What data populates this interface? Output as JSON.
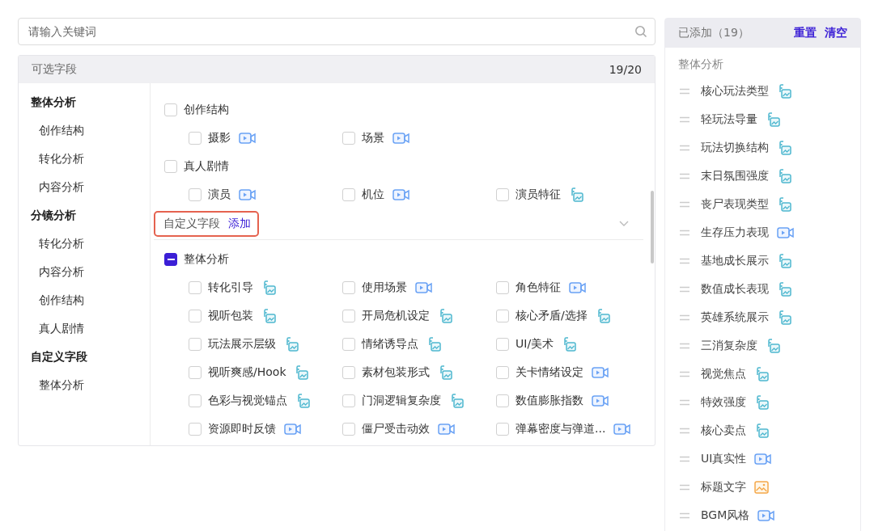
{
  "search": {
    "placeholder": "请输入关键词"
  },
  "fields_panel": {
    "title": "可选字段",
    "count": "19/20",
    "nav": [
      {
        "label": "整体分析",
        "kind": "group"
      },
      {
        "label": "创作结构",
        "kind": "item"
      },
      {
        "label": "转化分析",
        "kind": "item"
      },
      {
        "label": "内容分析",
        "kind": "item"
      },
      {
        "label": "分镜分析",
        "kind": "group"
      },
      {
        "label": "转化分析",
        "kind": "item"
      },
      {
        "label": "内容分析",
        "kind": "item"
      },
      {
        "label": "创作结构",
        "kind": "item"
      },
      {
        "label": "真人剧情",
        "kind": "item"
      },
      {
        "label": "自定义字段",
        "kind": "group"
      },
      {
        "label": "整体分析",
        "kind": "item"
      }
    ],
    "sections": [
      {
        "kind": "group",
        "label": "创作结构",
        "indeterminate": false,
        "items": [
          {
            "label": "摄影",
            "checked": false,
            "kind": "video"
          },
          {
            "label": "场景",
            "checked": false,
            "kind": "video"
          }
        ]
      },
      {
        "kind": "group",
        "label": "真人剧情",
        "indeterminate": false,
        "items": [
          {
            "label": "演员",
            "checked": false,
            "kind": "video"
          },
          {
            "label": "机位",
            "checked": false,
            "kind": "video"
          },
          {
            "label": "演员特征",
            "checked": false,
            "kind": "mixed"
          }
        ]
      },
      {
        "kind": "heading",
        "label": "自定义字段",
        "action": "添加",
        "expanded": false
      },
      {
        "kind": "group",
        "label": "整体分析",
        "indeterminate": true,
        "items": [
          {
            "label": "转化引导",
            "checked": false,
            "kind": "mixed"
          },
          {
            "label": "使用场景",
            "checked": false,
            "kind": "video"
          },
          {
            "label": "角色特征",
            "checked": false,
            "kind": "video"
          },
          {
            "label": "视听包装",
            "checked": false,
            "kind": "mixed"
          },
          {
            "label": "开局危机设定",
            "checked": false,
            "kind": "mixed"
          },
          {
            "label": "核心矛盾/选择",
            "checked": false,
            "kind": "mixed"
          },
          {
            "label": "玩法展示层级",
            "checked": false,
            "kind": "mixed"
          },
          {
            "label": "情绪诱导点",
            "checked": false,
            "kind": "mixed"
          },
          {
            "label": "UI/美术",
            "checked": false,
            "kind": "mixed"
          },
          {
            "label": "视听爽感/Hook",
            "checked": false,
            "kind": "mixed"
          },
          {
            "label": "素材包装形式",
            "checked": false,
            "kind": "mixed"
          },
          {
            "label": "关卡情绪设定",
            "checked": false,
            "kind": "video"
          },
          {
            "label": "色彩与视觉锚点",
            "checked": false,
            "kind": "mixed"
          },
          {
            "label": "门洞逻辑复杂度",
            "checked": false,
            "kind": "mixed"
          },
          {
            "label": "数值膨胀指数",
            "checked": false,
            "kind": "video"
          },
          {
            "label": "资源即时反馈",
            "checked": false,
            "kind": "video"
          },
          {
            "label": "僵尸受击动效",
            "checked": false,
            "kind": "video"
          },
          {
            "label": "弹幕密度与弹道...",
            "checked": false,
            "kind": "video"
          }
        ]
      }
    ]
  },
  "added_panel": {
    "title": "已添加（19）",
    "actions": [
      "重置",
      "清空"
    ],
    "group": "整体分析",
    "items": [
      {
        "label": "核心玩法类型",
        "kind": "mixed"
      },
      {
        "label": "轻玩法导量",
        "kind": "mixed"
      },
      {
        "label": "玩法切换结构",
        "kind": "mixed"
      },
      {
        "label": "末日氛围强度",
        "kind": "mixed"
      },
      {
        "label": "丧尸表现类型",
        "kind": "mixed"
      },
      {
        "label": "生存压力表现",
        "kind": "video"
      },
      {
        "label": "基地成长展示",
        "kind": "mixed"
      },
      {
        "label": "数值成长表现",
        "kind": "mixed"
      },
      {
        "label": "英雄系统展示",
        "kind": "mixed"
      },
      {
        "label": "三消复杂度",
        "kind": "mixed"
      },
      {
        "label": "视觉焦点",
        "kind": "mixed"
      },
      {
        "label": "特效强度",
        "kind": "mixed"
      },
      {
        "label": "核心卖点",
        "kind": "mixed"
      },
      {
        "label": "UI真实性",
        "kind": "video"
      },
      {
        "label": "标题文字",
        "kind": "image"
      },
      {
        "label": "BGM风格",
        "kind": "video"
      }
    ]
  }
}
